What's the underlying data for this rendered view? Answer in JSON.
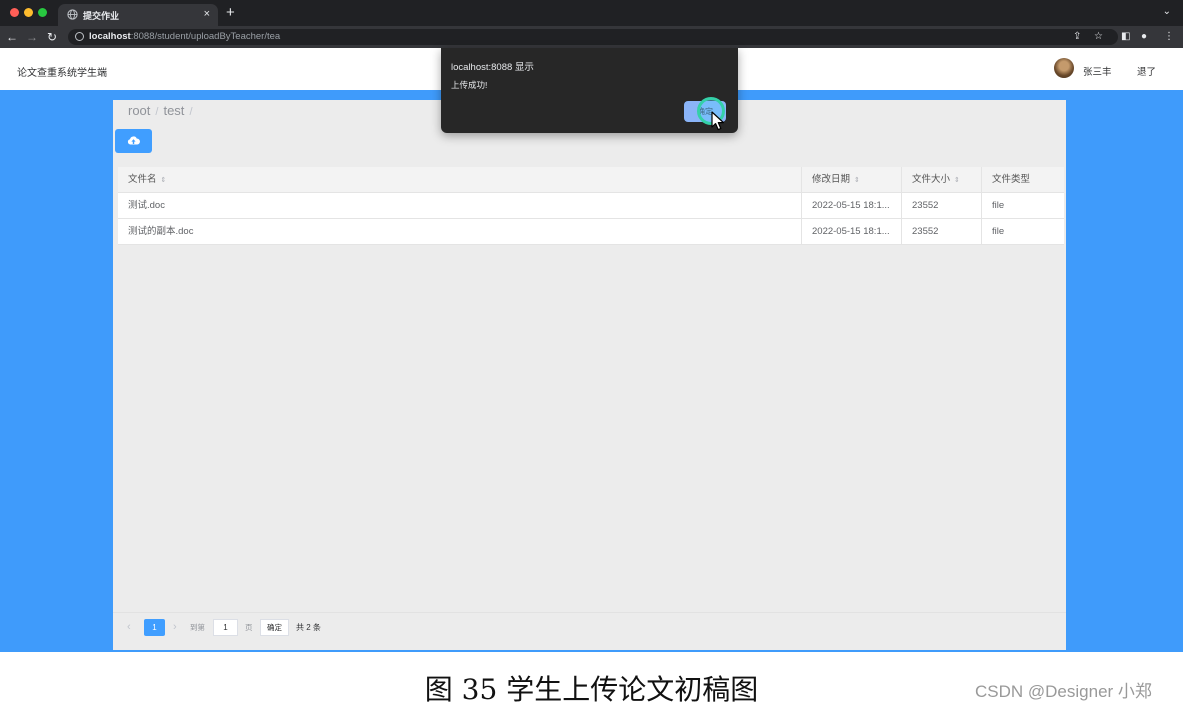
{
  "browser": {
    "tab_title": "提交作业",
    "new_tab_label": "+",
    "url_host": "localhost",
    "url_rest": ":8088/student/uploadByTeacher/tea"
  },
  "app": {
    "title": "论文查重系统学生端",
    "user_name": "张三丰",
    "logout_label": "退了"
  },
  "breadcrumb": {
    "items": [
      "root",
      "test"
    ],
    "separator": "/"
  },
  "table": {
    "headers": [
      "文件名",
      "修改日期",
      "文件大小",
      "文件类型"
    ],
    "rows": [
      {
        "name": "测试.doc",
        "modified": "2022-05-15 18:1...",
        "size": "23552",
        "type": "file"
      },
      {
        "name": "测试的副本.doc",
        "modified": "2022-05-15 18:1...",
        "size": "23552",
        "type": "file"
      }
    ]
  },
  "pagination": {
    "current_page": "1",
    "goto_label": "到第",
    "goto_value": "1",
    "page_label": "页",
    "confirm_label": "确定",
    "total_label": "共 2 条"
  },
  "dialog": {
    "title": "localhost:8088 显示",
    "message": "上传成功!",
    "ok_label": "确定"
  },
  "caption": {
    "text": "图 35 学生上传论文初稿图",
    "watermark": "CSDN @Designer 小郑"
  },
  "colors": {
    "accent": "#409eff",
    "page_background": "#3f9bfb",
    "dialog_background": "#272727",
    "dialog_button": "#8ab4f8"
  }
}
